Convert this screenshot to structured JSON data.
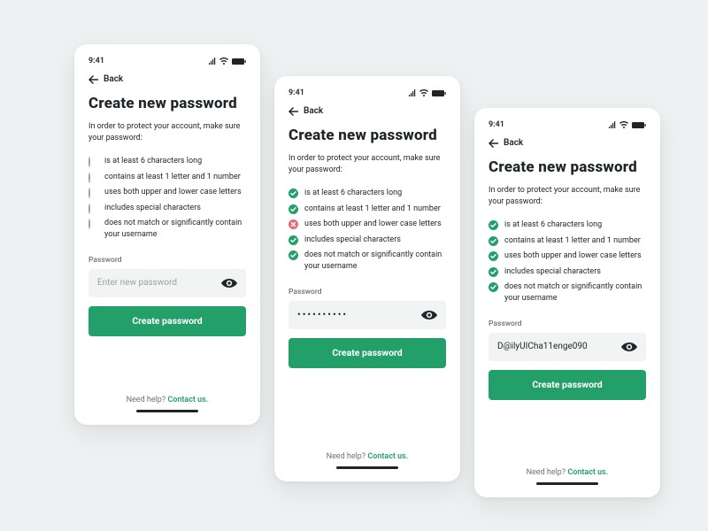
{
  "statusbar": {
    "time": "9:41"
  },
  "back_label": "Back",
  "title": "Create new password",
  "intro": "In order to protect your account, make sure your password:",
  "requirements": [
    "is at least 6 characters long",
    "contains at least 1 letter and 1 number",
    "uses both upper and lower case letters",
    "includes special characters",
    "does not match or significantly contain your username"
  ],
  "password_label": "Password",
  "cta_label": "Create password",
  "help": {
    "prefix": "Need help? ",
    "link": "Contact us."
  },
  "screens": {
    "empty": {
      "placeholder": "Enter new password",
      "value": "",
      "masked": false,
      "status": [
        "none",
        "none",
        "none",
        "none",
        "none"
      ]
    },
    "partial": {
      "value": "••••••••••",
      "masked": true,
      "status": [
        "ok",
        "ok",
        "fail",
        "ok",
        "ok"
      ]
    },
    "valid": {
      "value": "D@ilyUICha11enge090",
      "masked": false,
      "status": [
        "ok",
        "ok",
        "ok",
        "ok",
        "ok"
      ]
    }
  },
  "colors": {
    "accent": "#23a06a",
    "fail": "#e86b7a",
    "background": "#eef1f1"
  }
}
